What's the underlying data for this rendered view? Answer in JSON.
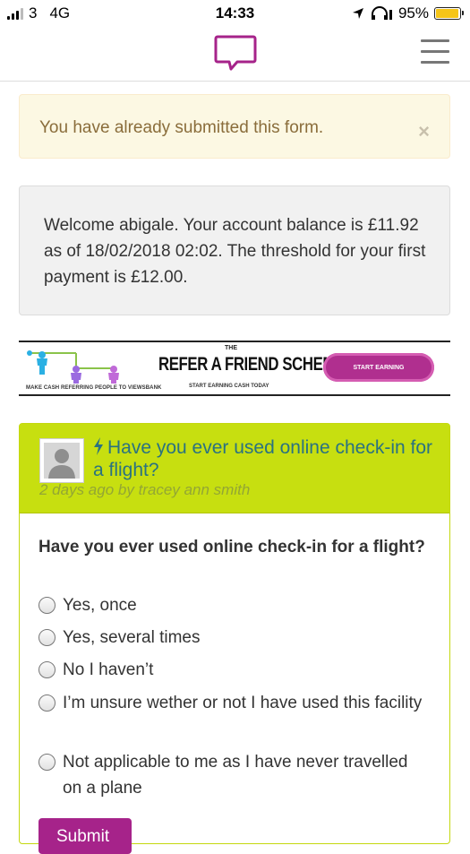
{
  "status_bar": {
    "carrier": "3",
    "network": "4G",
    "time": "14:33",
    "battery": "95%",
    "battery_level": 0.95
  },
  "alert": {
    "message": "You have already submitted this form.",
    "close": "×"
  },
  "welcome": {
    "text": "Welcome abigale. Your account balance is £11.92 as of 18/02/2018 02:02. The threshold for your first payment is £12.00."
  },
  "banner": {
    "the": "THE",
    "headline": "REFER A FRIEND SCHEME",
    "cta": "START EARNING",
    "caption": "MAKE CASH REFERRING PEOPLE TO VIEWSBANK",
    "subcaption": "START EARNING CASH TODAY"
  },
  "survey": {
    "title": "Have you ever used online check-in for a flight?",
    "meta": "2 days ago by tracey ann smith",
    "question": "Have you ever used online check-in for a flight?",
    "options": [
      "Yes, once",
      "Yes, several times",
      "No I haven’t",
      "I’m unsure wether or not I have used this facility",
      "Not applicable to me as I have never travelled on a plane"
    ],
    "submit": "Submit"
  },
  "colors": {
    "brand": "#a6238a",
    "card_header": "#c7df10",
    "title_link": "#2a7281",
    "alert_bg": "#fcf8e3"
  }
}
